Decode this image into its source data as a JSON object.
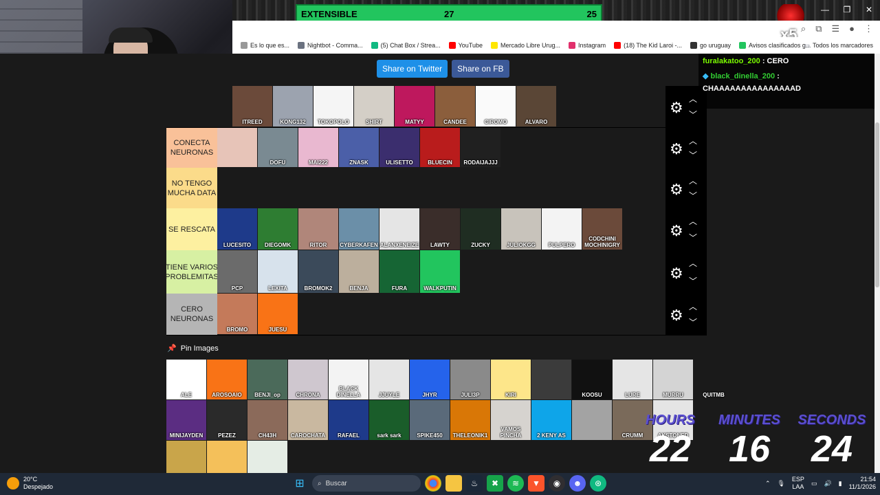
{
  "browser": {
    "extensible_bar": {
      "label": "EXTENSIBLE",
      "value1": "27",
      "value2": "25"
    },
    "window_controls": [
      "—",
      "❐",
      "✕"
    ],
    "bookmarks": [
      {
        "label": "Es lo que es...",
        "color": "#999999"
      },
      {
        "label": "Nightbot - Comma...",
        "color": "#6b7280"
      },
      {
        "label": "(5) Chat Box / Strea...",
        "color": "#10b981"
      },
      {
        "label": "YouTube",
        "color": "#ff0000"
      },
      {
        "label": "Mercado Libre Urug...",
        "color": "#ffe600"
      },
      {
        "label": "Instagram",
        "color": "#e1306c"
      },
      {
        "label": "(18) The Kid Laroi -...",
        "color": "#ff0000"
      },
      {
        "label": "go uruguay",
        "color": "#333333"
      },
      {
        "label": "Avisos clasificados g...",
        "color": "#22c55e"
      }
    ],
    "bookmarks_all": "Todos los marcadores",
    "badge": "x5"
  },
  "share": {
    "twitter": "Share on Twitter",
    "facebook": "Share on FB"
  },
  "tiers": [
    {
      "label": "",
      "color": "#1a1a1a",
      "items": [
        {
          "name": "ITREED",
          "bg": "#6b4a3a"
        },
        {
          "name": "KONG132",
          "bg": "#9ca3af"
        },
        {
          "name": "TOKOPOLO",
          "bg": "#f5f5f5"
        },
        {
          "name": "SHIRT",
          "bg": "#d4cfc7"
        },
        {
          "name": "MATYY",
          "bg": "#be185d"
        },
        {
          "name": "CANDEE",
          "bg": "#8b5e3c"
        },
        {
          "name": "CIROMO",
          "bg": "#fafafa"
        },
        {
          "name": "ALVARO",
          "bg": "#5a4636"
        }
      ]
    },
    {
      "label": "CONECTA NEURONAS",
      "color": "#f9c199",
      "items": [
        {
          "name": "",
          "bg": "#e7c4b8"
        },
        {
          "name": "DOFU",
          "bg": "#7a8a92"
        },
        {
          "name": "MAI222",
          "bg": "#e9b8d0"
        },
        {
          "name": "ZNASK",
          "bg": "#4b5fa8"
        },
        {
          "name": "ULISETTO",
          "bg": "#3b2e6e"
        },
        {
          "name": "BLUECIN",
          "bg": "#b91c1c"
        },
        {
          "name": "RODAIJAJJJ",
          "bg": "#202020"
        }
      ]
    },
    {
      "label": "NO TENGO MUCHA DATA",
      "color": "#fbdb8a",
      "items": []
    },
    {
      "label": "SE RESCATA",
      "color": "#fdf0a0",
      "items": [
        {
          "name": "LUCESITO",
          "bg": "#1e3a8a"
        },
        {
          "name": "DIEGOMK",
          "bg": "#2e7d32"
        },
        {
          "name": "RITOR",
          "bg": "#b0867a"
        },
        {
          "name": "CYBERKAFEN",
          "bg": "#6b8fa8"
        },
        {
          "name": "ALANXENEIZE",
          "bg": "#e5e5e5"
        },
        {
          "name": "LAWTY",
          "bg": "#3a2d2a"
        },
        {
          "name": "ZUCKY",
          "bg": "#1f2d22"
        },
        {
          "name": "JULIOKGG",
          "bg": "#c8c3bb"
        },
        {
          "name": "PULPERO",
          "bg": "#f3f3f3"
        },
        {
          "name": "CODCHINI MOCHINIGRY",
          "bg": "#6b4a3a"
        }
      ]
    },
    {
      "label": "TIENE VARIOS PROBLEMITAS",
      "color": "#d7f0a3",
      "items": [
        {
          "name": "PCP",
          "bg": "#6b6b6b"
        },
        {
          "name": "LEXITA",
          "bg": "#d7e2ec"
        },
        {
          "name": "BROMOK2",
          "bg": "#3b4a5a"
        },
        {
          "name": "BENJA",
          "bg": "#bcaf9d"
        },
        {
          "name": "FURA",
          "bg": "#166534"
        },
        {
          "name": "WALKPUTIN",
          "bg": "#22c55e"
        }
      ]
    },
    {
      "label": "CERO NEURONAS",
      "color": "#b5b5b5",
      "items": [
        {
          "name": "BROMO",
          "bg": "#c47a5a"
        },
        {
          "name": "JUESU",
          "bg": "#f97316"
        }
      ]
    }
  ],
  "pin": {
    "title": "Pin Images",
    "items": [
      {
        "name": "ALE",
        "bg": "#ffffff"
      },
      {
        "name": "AROSOAIO",
        "bg": "#f97316"
      },
      {
        "name": "BENJI_op",
        "bg": "#4b6a5a"
      },
      {
        "name": "CHRONA",
        "bg": "#cfc7cf"
      },
      {
        "name": "BLACK DINELLA",
        "bg": "#f3f3f3"
      },
      {
        "name": "JJUYLE",
        "bg": "#e5e5e5"
      },
      {
        "name": "JHYR",
        "bg": "#2563eb"
      },
      {
        "name": "JULI3P",
        "bg": "#8a8a8a"
      },
      {
        "name": "KIRI",
        "bg": "#fde68a"
      },
      {
        "name": "",
        "bg": "#3b3b3b"
      },
      {
        "name": "KOOSU",
        "bg": "#111111"
      },
      {
        "name": "LURE",
        "bg": "#e5e5e5"
      },
      {
        "name": "MURRU",
        "bg": "#d4d4d4"
      },
      {
        "name": "QUITMB",
        "bg": "#1a1a1a"
      },
      {
        "name": "MINIJAYDEN",
        "bg": "#5b2d82"
      },
      {
        "name": "PEZEZ",
        "bg": "#2a2a2a"
      },
      {
        "name": "CH43H",
        "bg": "#8b6a5a"
      },
      {
        "name": "CAROCHATA",
        "bg": "#c9b8a0"
      },
      {
        "name": "RAFAEL",
        "bg": "#1e3a8a"
      },
      {
        "name": "sark sark",
        "bg": "#1a5d2a"
      },
      {
        "name": "SPIKE450",
        "bg": "#5a6a7a"
      },
      {
        "name": "THELEONIK1",
        "bg": "#d97706"
      },
      {
        "name": "VAMOS PINCHA",
        "bg": "#d6d3cf"
      },
      {
        "name": "2 KENY AS",
        "bg": "#0ea5e9"
      },
      {
        "name": "",
        "bg": "#a3a3a3"
      },
      {
        "name": "CRUMM",
        "bg": "#7a6a5a"
      },
      {
        "name": "AKSTONED",
        "bg": "#e5e5e5"
      },
      {
        "name": "",
        "bg": "#c9a54a"
      },
      {
        "name": "",
        "bg": "#f4c05a"
      },
      {
        "name": "",
        "bg": "#e5ede5"
      }
    ]
  },
  "chat": [
    {
      "user": "furalakatoo_200",
      "text": ": CERO"
    },
    {
      "user": "black_dinella_200",
      "text": ":"
    },
    {
      "user": "",
      "text": "CHAAAAAAAAAAAAAAAD"
    }
  ],
  "timer": {
    "hours_label": "HOURS",
    "hours": "22",
    "minutes_label": "MINUTES",
    "minutes": "16",
    "seconds_label": "SECONDS",
    "seconds": "24"
  },
  "taskbar": {
    "weather_temp": "20°C",
    "weather_desc": "Despejado",
    "search_placeholder": "Buscar",
    "lang1": "ESP",
    "lang2": "LAA",
    "time": "21:54",
    "date": "11/1/2026"
  },
  "icons": {
    "settings": "gear-icon",
    "up": "chevron-up-icon",
    "down": "chevron-down-icon",
    "pin": "pin-icon"
  }
}
